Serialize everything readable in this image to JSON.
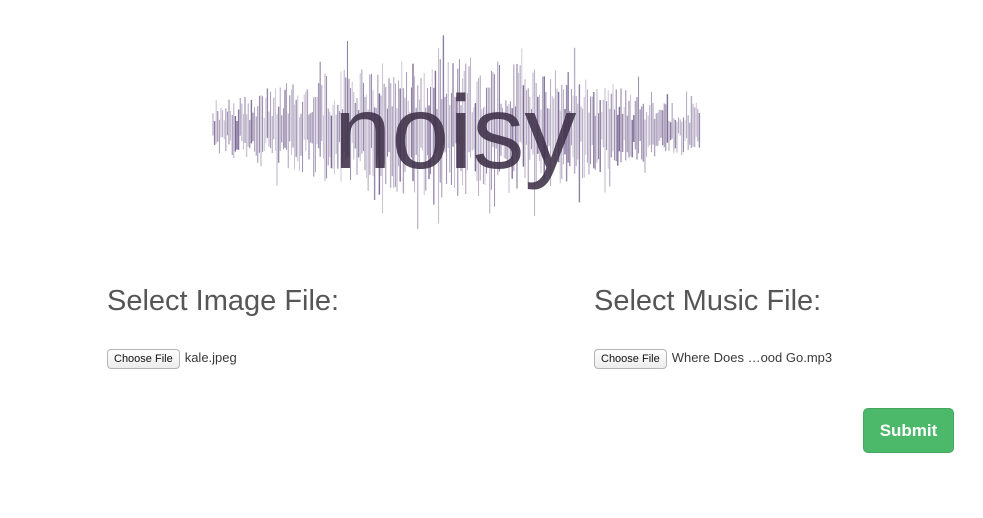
{
  "logo": {
    "text": "noisy",
    "wave_color": "#6a5587",
    "text_color": "#3d3048"
  },
  "image_section": {
    "title": "Select Image File:",
    "button_label": "Choose File",
    "file_name": "kale.jpeg"
  },
  "music_section": {
    "title": "Select Music File:",
    "button_label": "Choose File",
    "file_name": "Where Does …ood Go.mp3"
  },
  "submit": {
    "label": "Submit",
    "color": "#4cb86a"
  }
}
